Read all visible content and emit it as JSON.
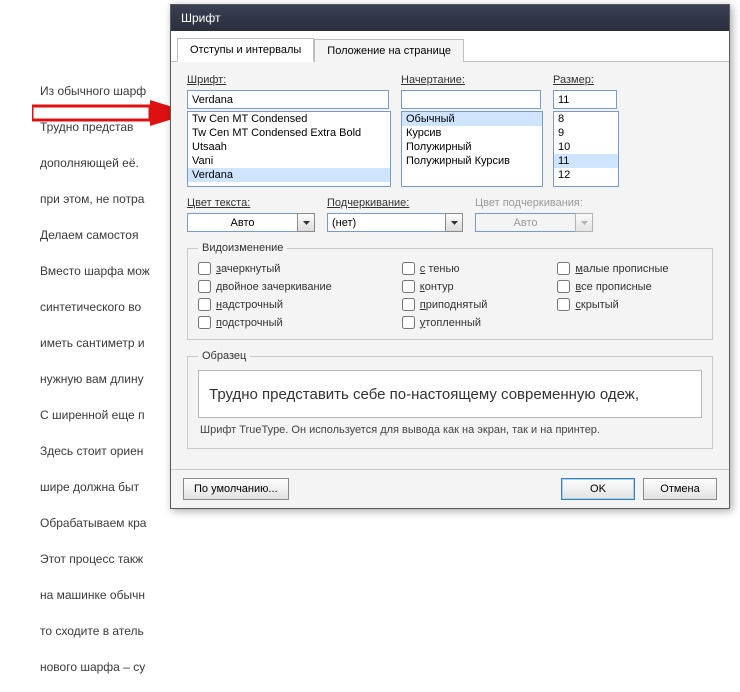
{
  "bg_paragraphs": [
    "Из обычного шарф",
    "Трудно представ",
    "дополняющей её.",
    "при этом, не потра",
    "Делаем самостоя",
    "Вместо шарфа мож",
    "синтетического во",
    "иметь сантиметр и",
    "нужную вам длину",
    " С ширенной еще п",
    "Здесь стоит ориен",
    "шире должна быт",
    "Обрабатываем кра",
    "Этот процесс такж",
    "на машинке обычн",
    "то сходите в атель",
    "нового шарфа – су"
  ],
  "dialog": {
    "title": "Шрифт",
    "tabs": [
      "Отступы и интервалы",
      "Положение на странице"
    ],
    "labels": {
      "font": "Шрифт:",
      "style": "Начертание:",
      "size": "Размер:",
      "color": "Цвет текста:",
      "underline": "Подчеркивание:",
      "ul_color": "Цвет подчеркивания:"
    },
    "font": {
      "value": "Verdana",
      "options": [
        "Tw Cen MT Condensed",
        "Tw Cen MT Condensed Extra Bold",
        "Utsaah",
        "Vani",
        "Verdana"
      ],
      "selected": "Verdana"
    },
    "style": {
      "value": "",
      "options": [
        "Обычный",
        "Курсив",
        "Полужирный",
        "Полужирный Курсив"
      ],
      "selected": "Обычный"
    },
    "size": {
      "value": "11",
      "options": [
        "8",
        "9",
        "10",
        "11",
        "12"
      ],
      "selected": "11"
    },
    "color_value": "Авто",
    "underline_value": "(нет)",
    "ul_color_value": "Авто",
    "effects_legend": "Видоизменение",
    "effects": {
      "c0": [
        "зачеркнутый",
        "двойное зачеркивание",
        "надстрочный",
        "подстрочный"
      ],
      "c1": [
        "с тенью",
        "контур",
        "приподнятый",
        "утопленный"
      ],
      "c2": [
        "малые прописные",
        "все прописные",
        "скрытый"
      ]
    },
    "sample_legend": "Образец",
    "sample_text": "Трудно представить себе по-настоящему современную одеж,",
    "hint": "Шрифт TrueType. Он используется для вывода как на экран, так и на принтер.",
    "buttons": {
      "default": "По умолчанию...",
      "ok": "OK",
      "cancel": "Отмена"
    }
  }
}
